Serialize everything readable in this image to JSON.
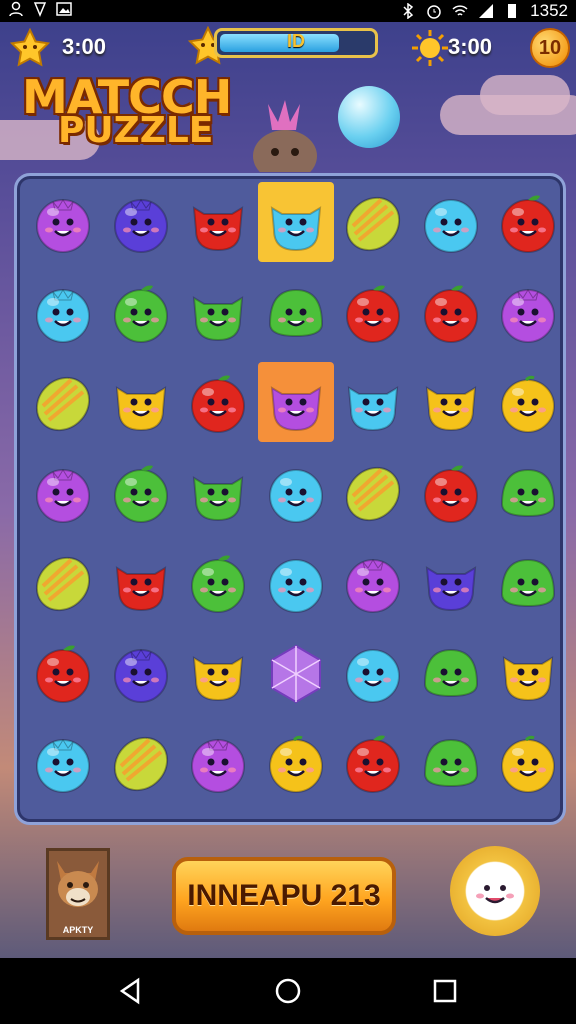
{
  "status_bar": {
    "left_icons": [
      "person-icon",
      "sim-icon",
      "image-icon"
    ],
    "time": "1352"
  },
  "hud": {
    "left_timer": "3:00",
    "right_timer": "3:00",
    "progress_label": "ID",
    "progress_fraction": 0.78,
    "coins": "10"
  },
  "logo": {
    "line1": "MATCCH",
    "line2": "PUZZLE"
  },
  "board": {
    "rows": 7,
    "cols": 7,
    "selected": [
      [
        0,
        3,
        "yellow"
      ],
      [
        2,
        3,
        "orange"
      ]
    ],
    "grid": [
      [
        "purple-berry",
        "indigo-berry",
        "red-cat",
        "cyan-cat",
        "striped-candy",
        "cyan-ball",
        "red-apple"
      ],
      [
        "cyan-berry",
        "green-apple",
        "green-cat",
        "green-slime",
        "red-apple",
        "red-apple",
        "purple-berry"
      ],
      [
        "striped-candy",
        "yellow-cat",
        "red-apple",
        "purple-cat",
        "cyan-cat",
        "yellow-cat",
        "yellow-lemon"
      ],
      [
        "purple-berry",
        "green-apple",
        "green-cat",
        "cyan-ball",
        "striped-candy",
        "red-apple",
        "green-slime"
      ],
      [
        "striped-candy",
        "red-cat",
        "green-apple",
        "cyan-ball",
        "purple-berry",
        "indigo-cat",
        "green-slime"
      ],
      [
        "red-apple",
        "indigo-berry",
        "yellow-cat",
        "crystal-gem",
        "cyan-ball",
        "green-slime",
        "yellow-cat"
      ],
      [
        "cyan-berry",
        "striped-candy",
        "purple-berry",
        "yellow-lemon",
        "red-apple",
        "green-slime",
        "yellow-lemon"
      ]
    ]
  },
  "bottom": {
    "avatar_label": "APKTY",
    "main_button": "INNEAPU 213"
  },
  "colors": {
    "purple": "#b44ee0",
    "indigo": "#5a3fd8",
    "red": "#e0261e",
    "cyan": "#4ac8f0",
    "green": "#4cc03a",
    "yellow": "#f5c21a",
    "candy": "#d8d84a"
  }
}
